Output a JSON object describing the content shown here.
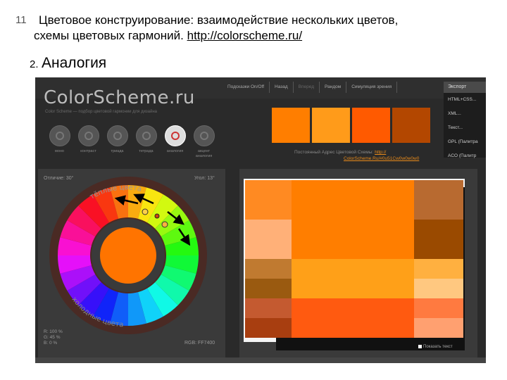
{
  "slide": {
    "number": "11",
    "heading_bold": "Цветовое конструирование",
    "heading_rest": ": взаимодействие нескольких цветов,",
    "heading_line2": "схемы цветовых гармоний.",
    "heading_link": "http://colorscheme.ru/",
    "sub_number": "2.",
    "sub_title": "Аналогия"
  },
  "app": {
    "logo": "ColorScheme.ru",
    "tagline": "Color Scheme — подбор цветовой гармонии для дизайна",
    "menu": [
      {
        "label": "Подсказки On/Off",
        "dim": false
      },
      {
        "label": "Назад",
        "dim": false
      },
      {
        "label": "Вперед",
        "dim": true
      },
      {
        "label": "Рандом",
        "dim": false
      },
      {
        "label": "Симуляция зрения",
        "dim": false
      }
    ],
    "export_label": "Экспорт",
    "export_menu": [
      "HTML+CSS...",
      "XML...",
      "Текст...",
      "GPL (Палитра",
      "ACO (Палитр"
    ],
    "modes": [
      {
        "label": "моно",
        "active": false
      },
      {
        "label": "контраст",
        "active": false
      },
      {
        "label": "триада",
        "active": false
      },
      {
        "label": "тетрада",
        "active": false
      },
      {
        "label": "аналогия",
        "active": true
      },
      {
        "label": "акцент аналогия",
        "active": false
      }
    ],
    "swatches": [
      "#ff7e00",
      "#ff9b1a",
      "#ff5a00",
      "#b34700"
    ],
    "address_label": "Постоянный Адрес Цветовой Схемы:",
    "address_url_1": "http://",
    "address_url_2": "ColorScheme.Ru/#0u51Cw0w0w0w0",
    "wheel": {
      "distance_label": "Отличие:",
      "distance_value": "30°",
      "angle_label": "Угол:",
      "angle_value": "13°",
      "warm_label": "тёплые цвета",
      "cold_label": "холодные цвета",
      "r_label": "R: 100 %",
      "g_label": "G: 45 %",
      "b_label": "B: 0 %",
      "rgb_label": "RGB: FF7400",
      "center_color": "#ff7400"
    },
    "preview": {
      "checkbox_label": "Показать текст"
    }
  }
}
